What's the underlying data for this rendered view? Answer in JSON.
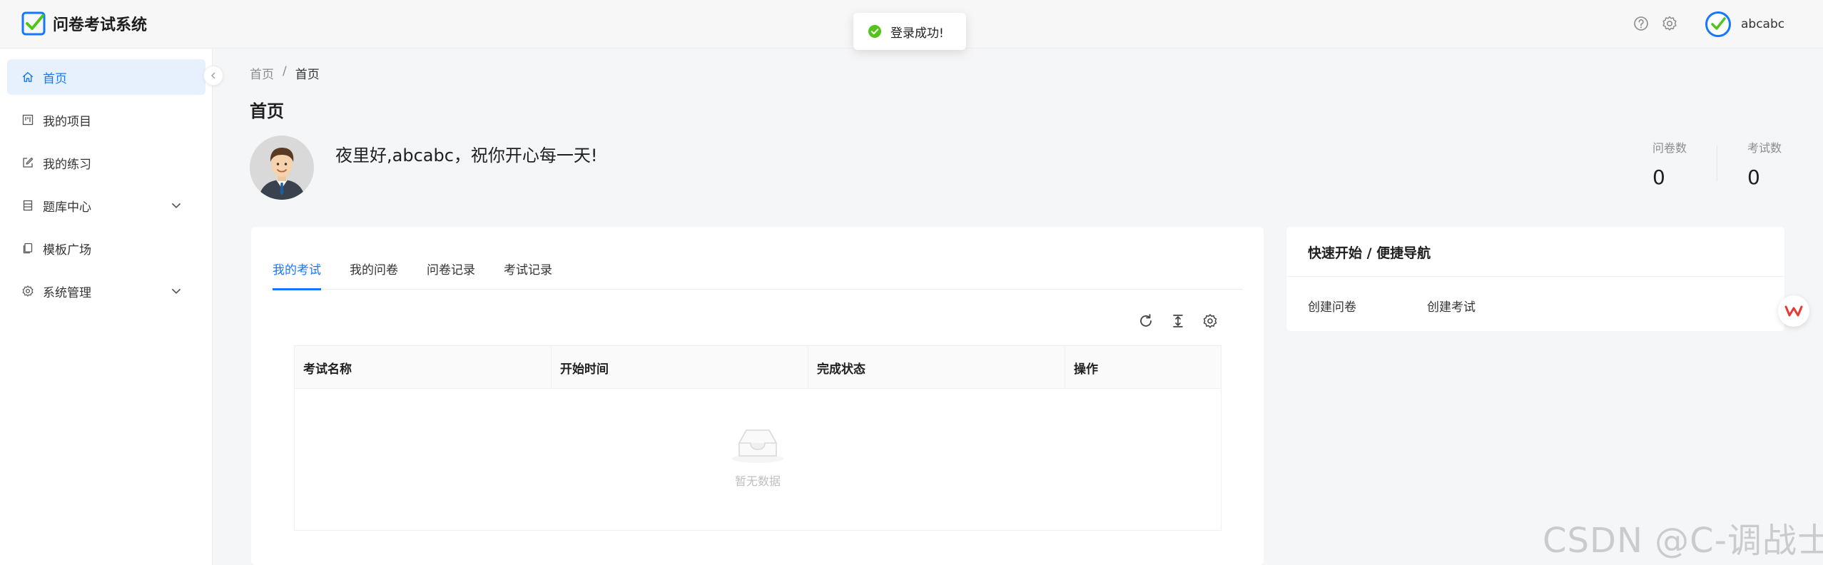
{
  "app": {
    "title": "问卷考试系统"
  },
  "header": {
    "username": "abcabc"
  },
  "toast": {
    "message": "登录成功!"
  },
  "sidebar": {
    "items": [
      {
        "label": "首页",
        "icon": "home-icon",
        "active": true
      },
      {
        "label": "我的项目",
        "icon": "project-icon"
      },
      {
        "label": "我的练习",
        "icon": "edit-icon"
      },
      {
        "label": "题库中心",
        "icon": "bank-icon",
        "expandable": true
      },
      {
        "label": "模板广场",
        "icon": "template-icon"
      },
      {
        "label": "系统管理",
        "icon": "settings-icon",
        "expandable": true
      }
    ]
  },
  "breadcrumb": {
    "root": "首页",
    "separator": "/",
    "current": "首页"
  },
  "page": {
    "title": "首页"
  },
  "welcome": {
    "greeting": "夜里好,abcabc，祝你开心每一天!",
    "stats": [
      {
        "label": "问卷数",
        "value": "0"
      },
      {
        "label": "考试数",
        "value": "0"
      }
    ]
  },
  "tabs": [
    "我的考试",
    "我的问卷",
    "问卷记录",
    "考试记录"
  ],
  "table": {
    "columns": [
      "考试名称",
      "开始时间",
      "完成状态",
      "操作"
    ],
    "empty_text": "暂无数据"
  },
  "quick_nav": {
    "title": "快速开始 / 便捷导航",
    "links": [
      "创建问卷",
      "创建考试"
    ]
  },
  "watermark": "CSDN @C-调战士",
  "colors": {
    "primary": "#1677ff",
    "success": "#52c41a",
    "active_bg": "#e6f1fd"
  }
}
